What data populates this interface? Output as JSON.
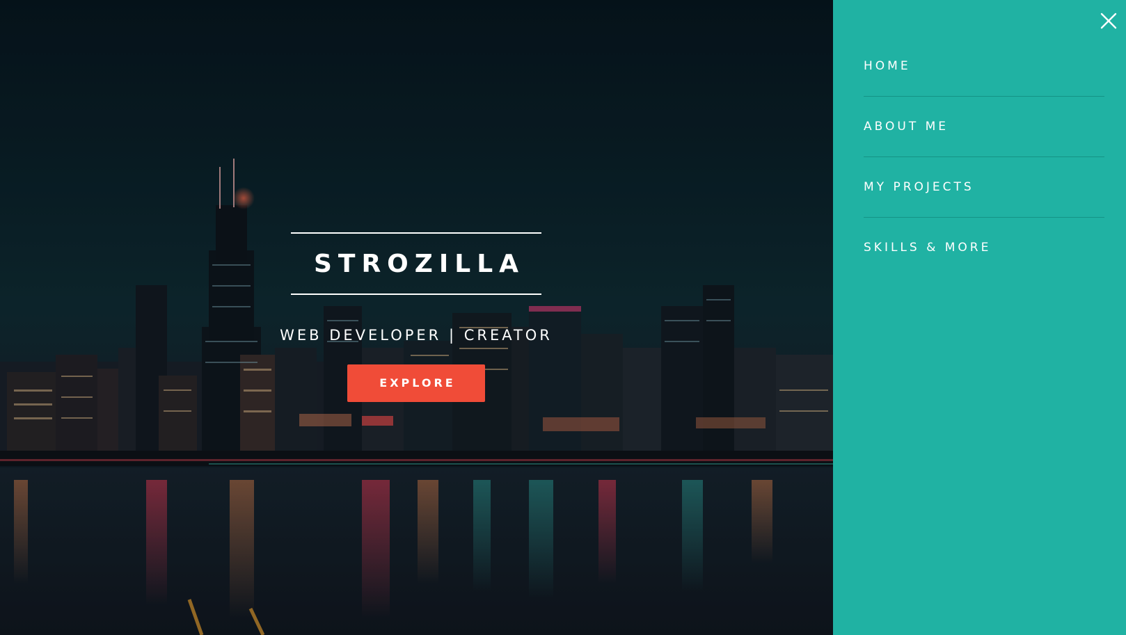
{
  "hero": {
    "title": "STROZILLA",
    "subtitle": "WEB DEVELOPER | CREATOR",
    "cta_label": "EXPLORE"
  },
  "sidenav": {
    "close_icon": "close-icon",
    "items": [
      {
        "label": "HOME"
      },
      {
        "label": "ABOUT ME"
      },
      {
        "label": "MY PROJECTS"
      },
      {
        "label": "SKILLS & MORE"
      }
    ]
  },
  "colors": {
    "nav_background": "#20b2a3",
    "cta_background": "#f04c38",
    "hero_background": "#0b1a22",
    "text": "#ffffff"
  }
}
